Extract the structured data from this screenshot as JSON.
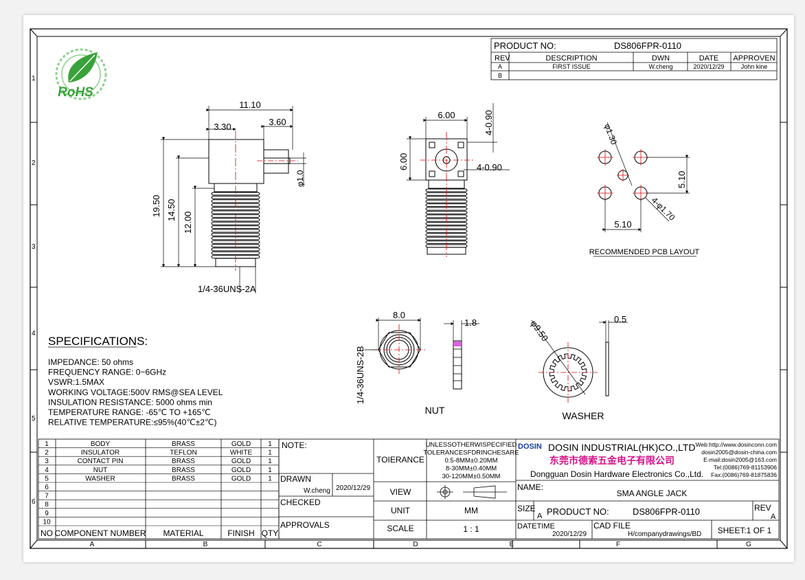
{
  "title_block_top": {
    "product_no_label": "PRODUCT NO:",
    "product_no": "DS806FPR-0110",
    "headers": [
      "REV",
      "DESCRIPTION",
      "DWN",
      "DATE",
      "APPROVEN"
    ],
    "rows": [
      [
        "A",
        "FIRST ISSUE",
        "W.cheng",
        "2020/12/29",
        "John kine"
      ],
      [
        "B",
        "",
        "",
        "",
        ""
      ]
    ]
  },
  "border": {
    "row_numbers": [
      "1",
      "2",
      "3",
      "4",
      "5",
      "6"
    ],
    "col_letters": [
      "A",
      "B",
      "C",
      "D",
      "E",
      "F",
      "G"
    ]
  },
  "logo": {
    "text": "RoHS",
    "colors": {
      "green": "#3aa23a",
      "light_green": "#8ed08e"
    }
  },
  "side_view": {
    "dims": {
      "overall_width": "11.10",
      "left": "3.30",
      "right": "3.60",
      "pin_dia": "φ1.0",
      "h1": "19.50",
      "h2": "14.50",
      "h3": "12.00"
    },
    "thread": "1/4-36UNS-2A"
  },
  "front_view": {
    "dims": {
      "width": "6.00",
      "height": "6.00",
      "hole1": "4-0.90",
      "hole2": "4-0.90"
    }
  },
  "pcb_layout": {
    "dims": {
      "hole_small": "φ1.30",
      "hole_large": "4-φ1.70",
      "spacing_v": "5.10",
      "spacing_h": "5.10"
    },
    "caption": "RECOMMENDED PCB LAYOUT"
  },
  "nut": {
    "dims": {
      "width": "8.0",
      "thickness": "1.8",
      "thread": "1/4-36UNS-2B"
    },
    "caption": "NUT"
  },
  "washer": {
    "dims": {
      "dia": "φ9.50",
      "thickness": "0.5"
    },
    "caption": "WASHER"
  },
  "specifications": {
    "heading": "SPECIFICATIONS:",
    "lines": [
      "IMPEDANCE:  50 ohms",
      "FREQUENCY RANGE:  0~6GHz",
      "VSWR:1.5MAX",
      "WORKING VOLTAGE:500V RMS@SEA LEVEL",
      "INSULATION RESISTANCE:  5000 ohms min",
      "TEMPERATURE RANGE:  -65℃  TO  +165℃",
      "RELATIVE TEMPERATURE:≤95%(40℃±2℃)"
    ]
  },
  "bom": {
    "rows": [
      [
        "1",
        "BODY",
        "BRASS",
        "GOLD",
        "1"
      ],
      [
        "2",
        "INSULATOR",
        "TEFLON",
        "WHITE",
        "1"
      ],
      [
        "3",
        "CONTACT PIN",
        "BRASS",
        "GOLD",
        "1"
      ],
      [
        "4",
        "NUT",
        "BRASS",
        "GOLD",
        "1"
      ],
      [
        "5",
        "WASHER",
        "BRASS",
        "GOLD",
        "1"
      ],
      [
        "6",
        "",
        "",
        "",
        ""
      ],
      [
        "7",
        "",
        "",
        "",
        ""
      ],
      [
        "8",
        "",
        "",
        "",
        ""
      ],
      [
        "9",
        "",
        "",
        "",
        ""
      ],
      [
        "10",
        "",
        "",
        "",
        ""
      ]
    ],
    "headers": [
      "NO",
      "COMPONENT NUMBER",
      "MATERIAL",
      "FINISH",
      "QTY"
    ]
  },
  "title_block": {
    "note_label": "NOTE:",
    "drawn_label": "DRAWN",
    "drawn_by": "W.cheng",
    "drawn_date": "2020/12/29",
    "checked_label": "CHECKED",
    "approvals_label": "APPROVALS",
    "tolerance_label": "TOIERANCE",
    "tolerance_lines": [
      "UNLESSOTHERWISPECIFIED",
      "TOLERANCESFDRINCHESARE",
      "0.5-8MM±0.20MM",
      "8-30MM±0.40MM",
      "30-120MM±0.50MM"
    ],
    "view_label": "VIEW",
    "unit_label": "UNIT",
    "unit_value": "MM",
    "scale_label": "SCALE",
    "scale_value": "1 : 1",
    "company_logo": "DOSIN",
    "company_name": "DOSIN INDUSTRIAL(HK)CO.,LTD",
    "company_cn": "东莞市德索五金电子有限公司",
    "company_en": "Dongguan Dosin Hardware Electronics Co.,Ltd.",
    "contact": [
      "Web:http://www.dosinconn.com",
      "dosin2005@dosin-china.com",
      "E-mail:dosin2005@163.com",
      "Tel:(0086)769-81153906",
      "Fax:(0086)769-81875836"
    ],
    "name_label": "NAME:",
    "name_value": "SMA ANGLE JACK",
    "size_label": "SIZE",
    "size_value": "A",
    "product_no_label": "PRODUCT NO:",
    "product_no": "DS806FPR-0110",
    "rev_label": "REV",
    "rev_value": "A",
    "datetime_label": "DATETIME",
    "datetime_value": "2020/12/29",
    "cadfile_label": "CAD FILE",
    "cadfile_value": "H/companydrawings/BD",
    "sheet": "SHEET:1 OF 1",
    "brand_color": "#1a3ea8",
    "cn_color": "#d4148a"
  }
}
